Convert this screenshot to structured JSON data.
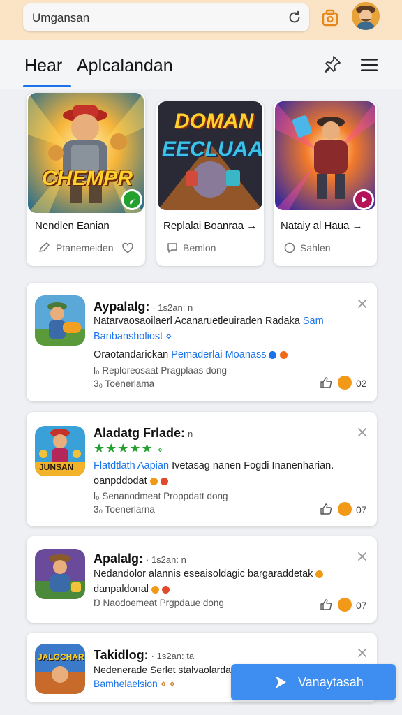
{
  "browser": {
    "url_text": "Umgansan"
  },
  "header": {
    "tab_home": "Hear",
    "tab_apps": "Aplcalandan"
  },
  "featured": [
    {
      "art_text": "CHEMPR",
      "title": "Nendlen Eanian",
      "subtitle": "Ptanemeiden"
    },
    {
      "art_text_top": "DOMAN",
      "art_text_bottom": "EECLUAAN",
      "title": "Replalai Boanraa →",
      "subtitle": "Bemlon"
    },
    {
      "title": "Nataiy al Haua →",
      "subtitle": "Sahlen"
    }
  ],
  "list": [
    {
      "title": "Aypalalg:",
      "meta": "· 1s2an: n",
      "desc_1": "Natarvaosaoilaerl Acanaruetleuiraden Radaka",
      "desc_1_link": "Sam",
      "desc_2_link": "Banbansholiost",
      "desc_2_tail": "⋄",
      "desc_3": "Oraotandarickan",
      "desc_3_link": "Pemaderlai Moanass",
      "line_1": "l₀ Reploreosaat Pragplaas dong",
      "line_2": "3₀ Toenerlama",
      "count": "02"
    },
    {
      "title": "Aladatg Frlade:",
      "meta": "n",
      "stars": "★★★★★",
      "stars_tail": "⋄",
      "desc_1_link": "Flatdtlath Aapian",
      "desc_1": "Ivetasag nanen Fogdi Inanenharian.",
      "desc_2": "oanpddodat",
      "line_1": "l₀ Senanodmeat Proppdatt dong",
      "line_2": "3₀ Toenerlarna",
      "count": "07"
    },
    {
      "title": "Apalalg:",
      "meta": "· 1s2an: n",
      "desc_1": "Nedandolor alannis eseaisoldagic bargaraddetak",
      "desc_2": "danpaldonal",
      "line_1": "Ŋ Naodoemeat Prgpdaue dong",
      "count": "07"
    },
    {
      "title": "Takidlog:",
      "meta": "· 1s2an: ta",
      "desc_1": "Nedenerade Serlet stalvaolarday",
      "desc_2_link": "Bamhelaelsion",
      "desc_2_tail": "⋄ ⋄"
    }
  ],
  "fab": {
    "label": "Vanaytasah"
  },
  "colors": {
    "accent": "#1a73e8",
    "topbar": "#fbe4c6",
    "fab": "#3d8ef0",
    "stars": "#22a12f"
  }
}
